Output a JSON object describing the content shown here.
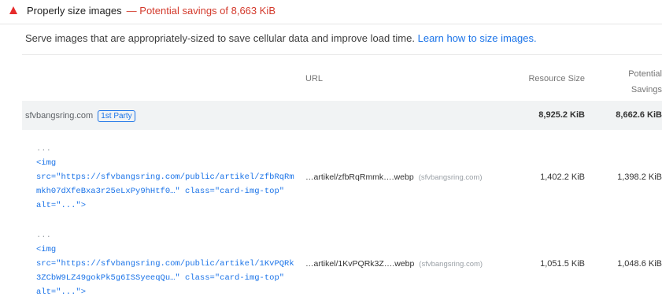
{
  "audit": {
    "title": "Properly size images",
    "savings": "— Potential savings of 8,663 KiB",
    "description": "Serve images that are appropriately-sized to save cellular data and improve load time.",
    "learn_link": "Learn how to size images."
  },
  "table": {
    "headers": {
      "url": "URL",
      "resource_size": "Resource Size",
      "potential_savings_1": "Potential",
      "potential_savings_2": "Savings"
    },
    "group": {
      "domain": "sfvbangsring.com",
      "badge": "1st Party",
      "resource_size": "8,925.2 KiB",
      "savings": "8,662.6 KiB"
    },
    "rows": [
      {
        "ellipsis": "...",
        "code_line1": "<img",
        "code_line2": "src=\"https://sfvbangsring.com/public/artikel/zfbRqRm",
        "code_line3": "mkh07dXfeBxa3r25eLxPy9hHtf0…\" class=\"card-img-top\"",
        "code_line4": "alt=\"...\">",
        "url": "…artikel/zfbRqRmmk….webp",
        "origin": "(sfvbangsring.com)",
        "resource_size": "1,402.2 KiB",
        "savings": "1,398.2 KiB"
      },
      {
        "ellipsis": "...",
        "code_line1": "<img",
        "code_line2": "src=\"https://sfvbangsring.com/public/artikel/1KvPQRk",
        "code_line3": "3ZCbW9LZ49gokPk5g6ISSyeeqQu…\" class=\"card-img-top\"",
        "code_line4": "alt=\"...\">",
        "url": "…artikel/1KvPQRk3Z….webp",
        "origin": "(sfvbangsring.com)",
        "resource_size": "1,051.5 KiB",
        "savings": "1,048.6 KiB"
      }
    ]
  },
  "colors": {
    "fail": "#e62c2c",
    "link": "#1a73e8",
    "group_bg": "#f1f3f4"
  }
}
